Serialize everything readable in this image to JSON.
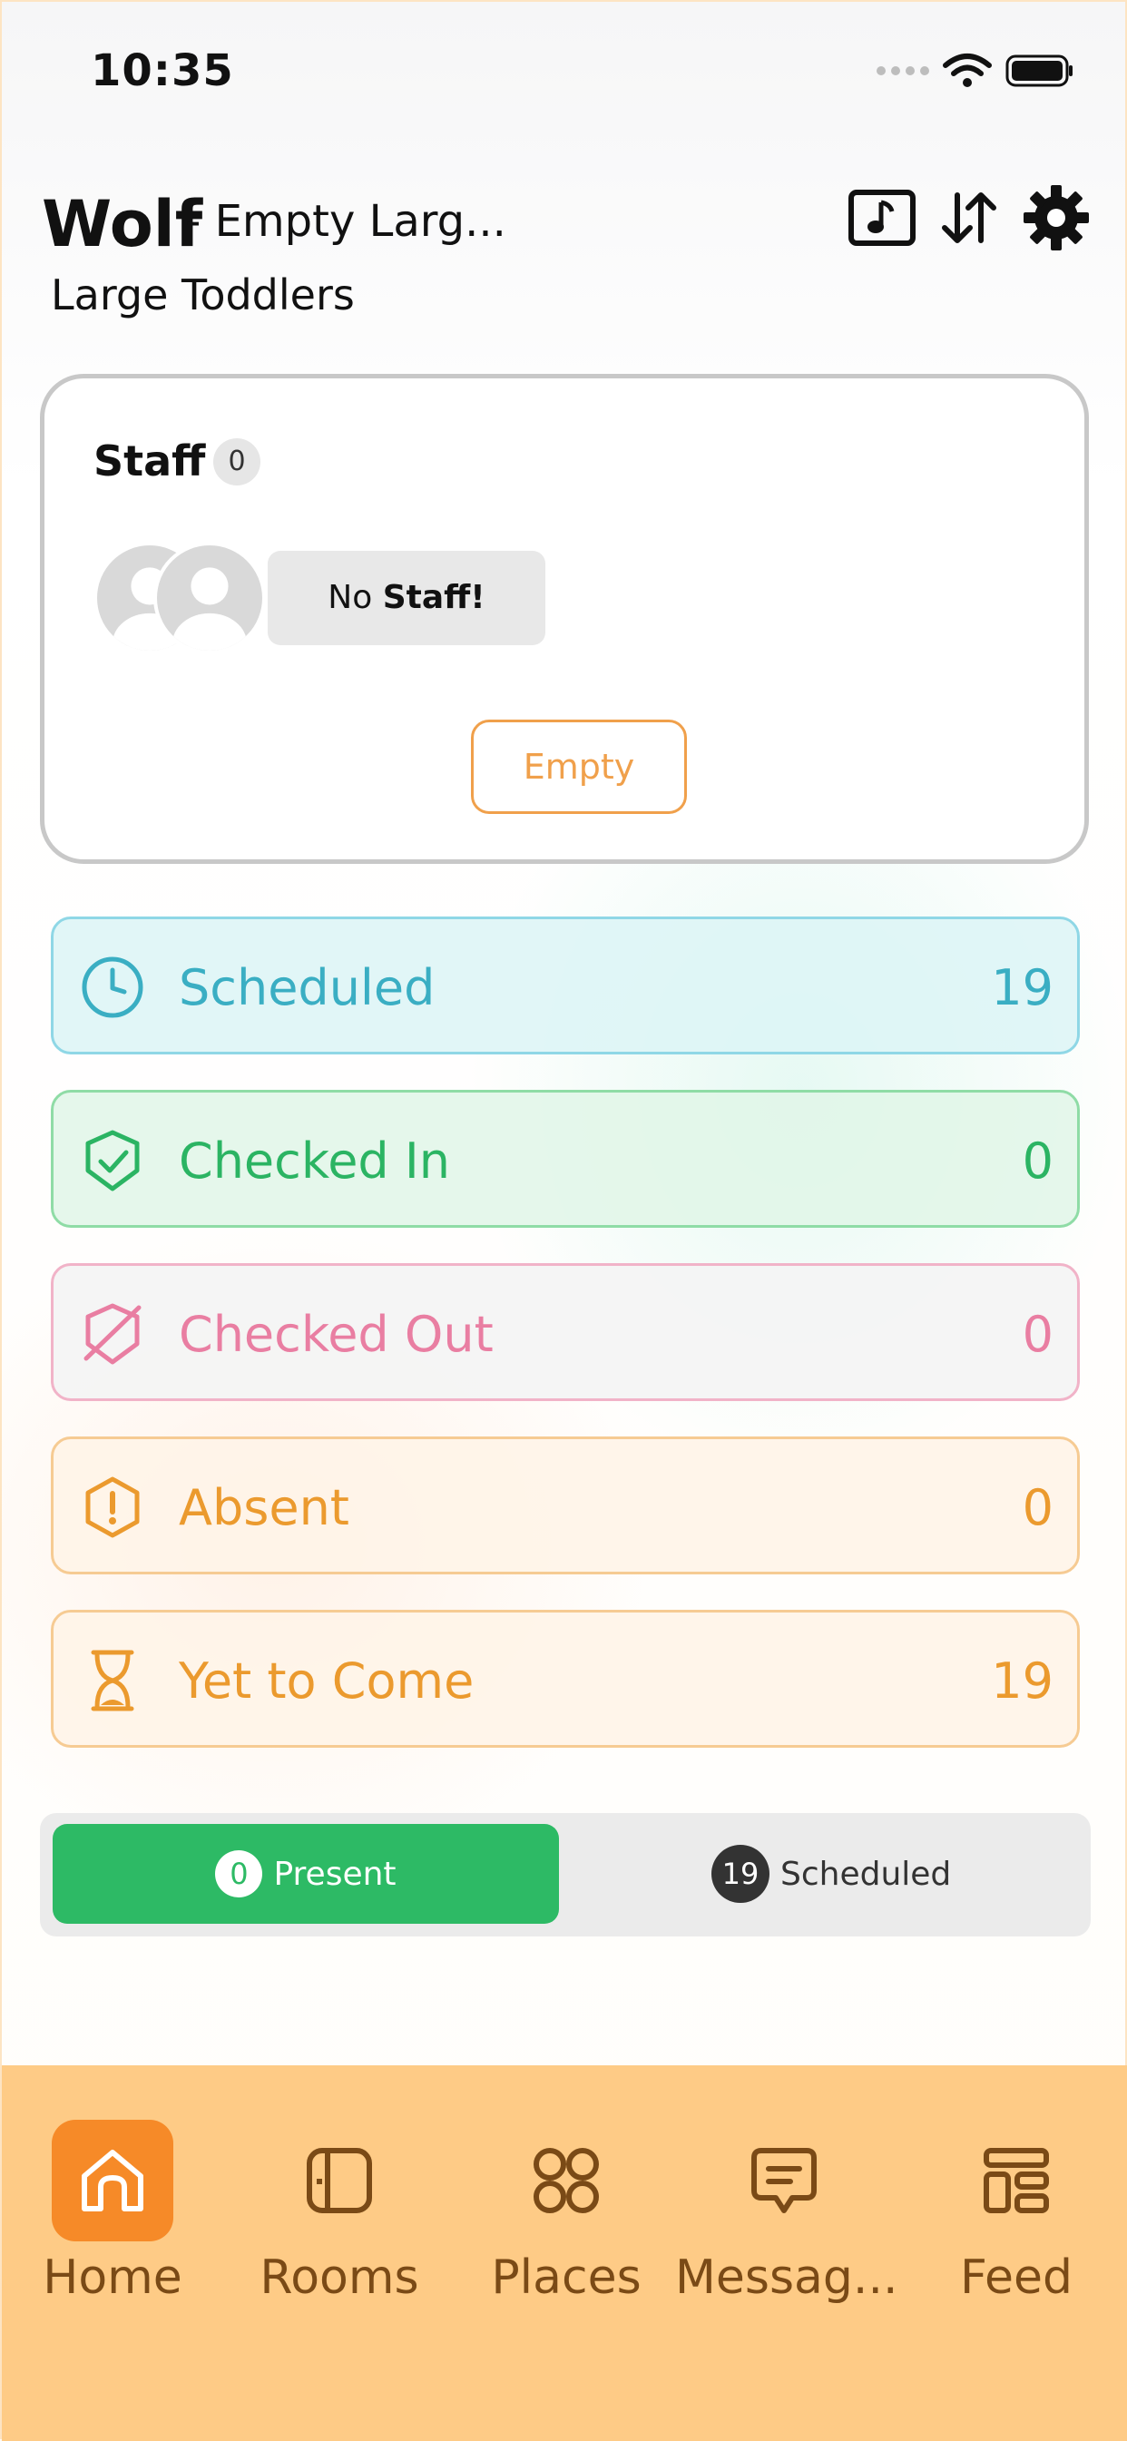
{
  "status_bar": {
    "time": "10:35"
  },
  "header": {
    "title": "Wolf",
    "subtitle": "- Empty Larg...",
    "room": "Large Toddlers"
  },
  "staff": {
    "label": "Staff",
    "count": "0",
    "no_staff_prefix": "No",
    "no_staff_text": "Staff!",
    "action": "Empty"
  },
  "statuses": [
    {
      "label": "Scheduled",
      "count": "19",
      "icon": "clock-icon",
      "color": "#3aaec3"
    },
    {
      "label": "Checked In",
      "count": "0",
      "icon": "shield-check-icon",
      "color": "#2bb463"
    },
    {
      "label": "Checked Out",
      "count": "0",
      "icon": "shield-off-icon",
      "color": "#e97ea2"
    },
    {
      "label": "Absent",
      "count": "0",
      "icon": "alert-hexagon-icon",
      "color": "#eb9a2e"
    },
    {
      "label": "Yet to Come",
      "count": "19",
      "icon": "hourglass-icon",
      "color": "#eb9a2e"
    }
  ],
  "segment": {
    "present": {
      "count": "0",
      "label": "Present"
    },
    "scheduled": {
      "count": "19",
      "label": "Scheduled"
    }
  },
  "tabs": [
    {
      "label": "Home",
      "icon": "home-icon"
    },
    {
      "label": "Rooms",
      "icon": "rooms-icon"
    },
    {
      "label": "Places",
      "icon": "places-icon"
    },
    {
      "label": "Messag...",
      "icon": "message-icon"
    },
    {
      "label": "Feed",
      "icon": "feed-icon"
    }
  ],
  "colors": {
    "accent": "#f68a28",
    "tabbar": "#fecb86",
    "present": "#2dba65"
  }
}
